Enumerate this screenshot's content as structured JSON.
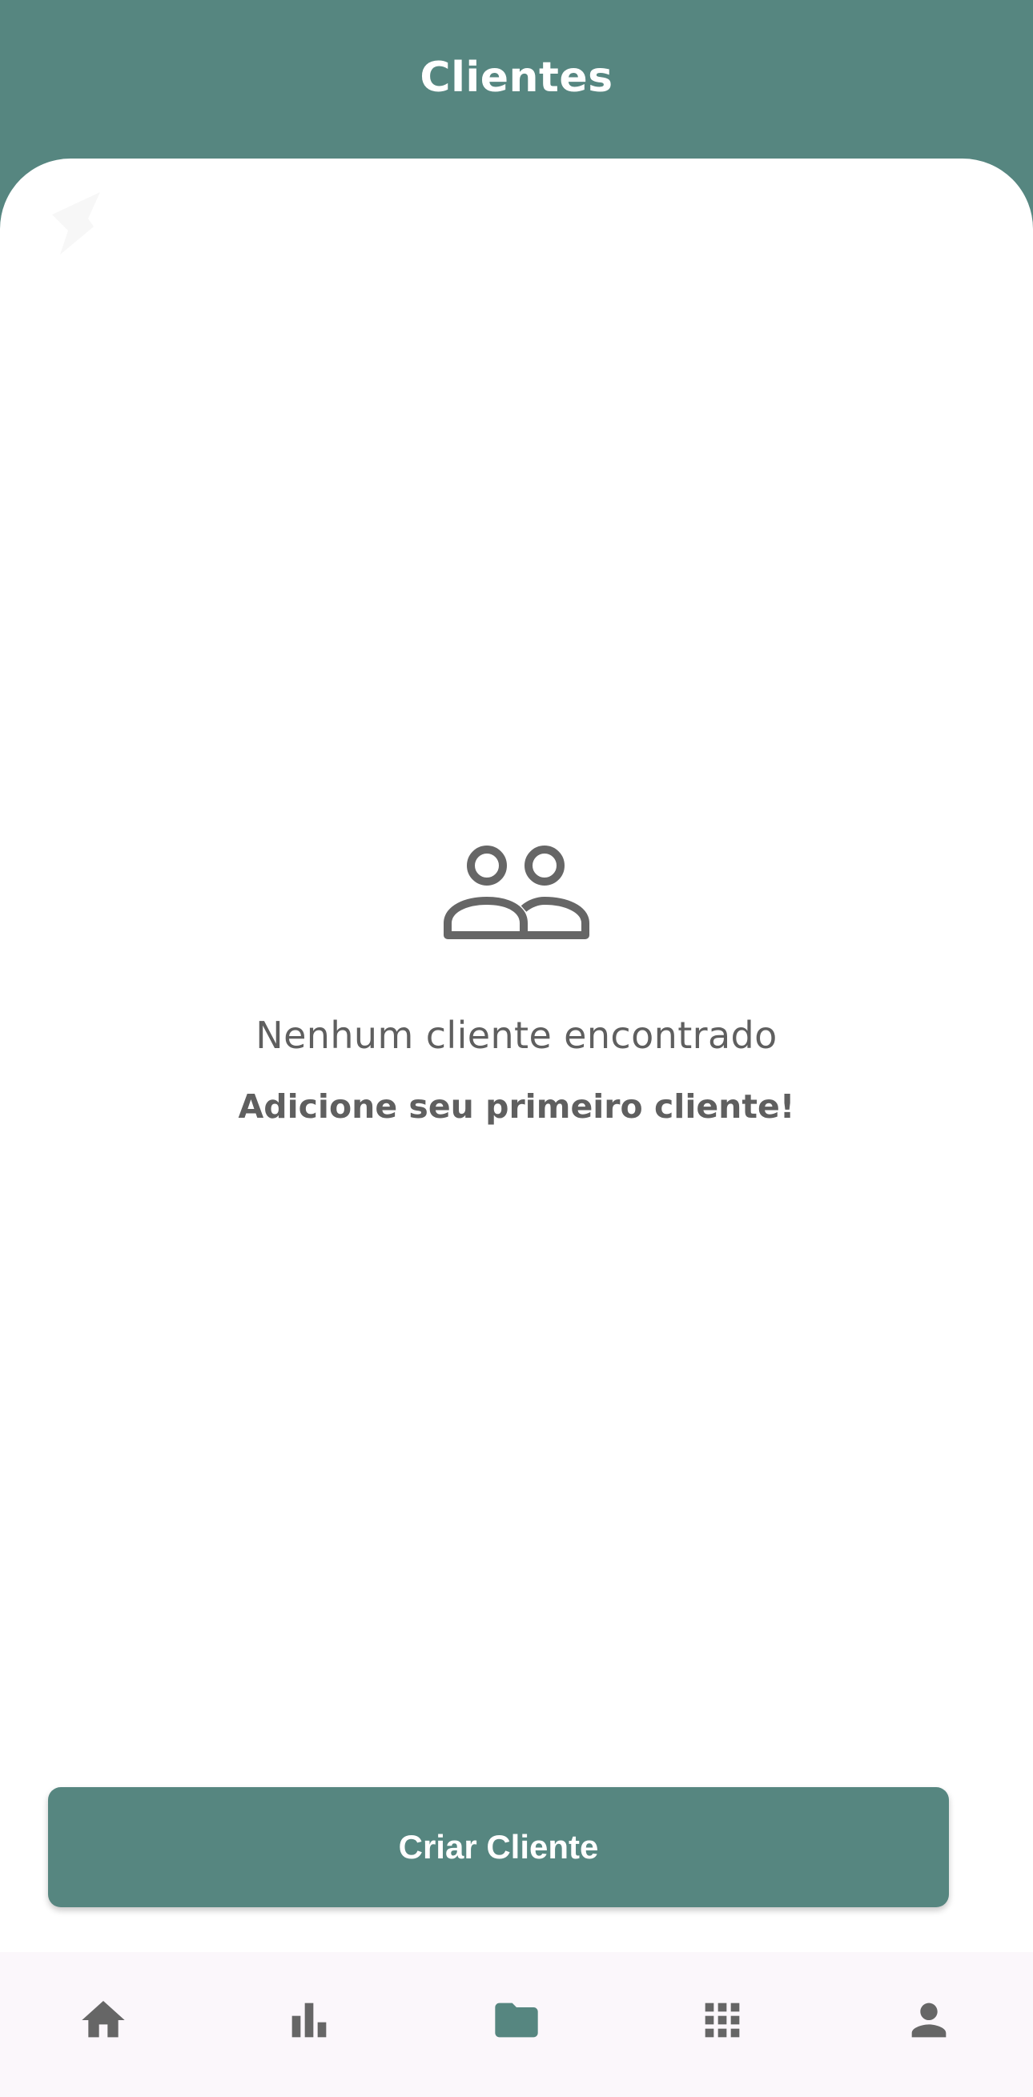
{
  "header": {
    "title": "Clientes"
  },
  "empty_state": {
    "icon": "people-icon",
    "title": "Nenhum cliente encontrado",
    "subtitle": "Adicione seu primeiro cliente!"
  },
  "actions": {
    "create_label": "Criar Cliente"
  },
  "bottom_nav": {
    "items": [
      {
        "icon": "home-icon",
        "active": false
      },
      {
        "icon": "bar-chart-icon",
        "active": false
      },
      {
        "icon": "folder-icon",
        "active": true
      },
      {
        "icon": "apps-grid-icon",
        "active": false
      },
      {
        "icon": "person-icon",
        "active": false
      }
    ]
  },
  "colors": {
    "primary": "#568680",
    "icon_inactive": "#666666",
    "text_muted": "#5f5f5f",
    "surface": "#ffffff",
    "nav_background": "#fbf7fb"
  }
}
